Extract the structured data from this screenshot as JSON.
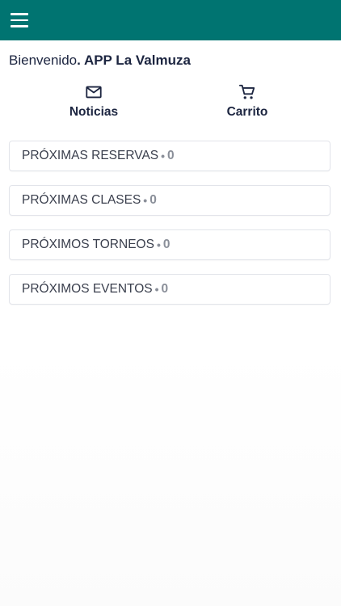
{
  "header": {
    "menu_icon": "hamburger-menu-icon",
    "color": "#007471"
  },
  "welcome": {
    "prefix": "Bienvenido",
    "app_name": ". APP La Valmuza"
  },
  "quick_actions": [
    {
      "label": "Noticias",
      "icon": "mail-icon"
    },
    {
      "label": "Carrito",
      "icon": "shopping-cart-icon"
    }
  ],
  "sections": [
    {
      "label": "PRÓXIMAS RESERVAS",
      "separator": "•",
      "count": "0"
    },
    {
      "label": "PRÓXIMAS CLASES",
      "separator": "•",
      "count": "0"
    },
    {
      "label": "PRÓXIMOS TORNEOS",
      "separator": "•",
      "count": "0"
    },
    {
      "label": "PRÓXIMOS EVENTOS",
      "separator": "•",
      "count": "0"
    }
  ]
}
